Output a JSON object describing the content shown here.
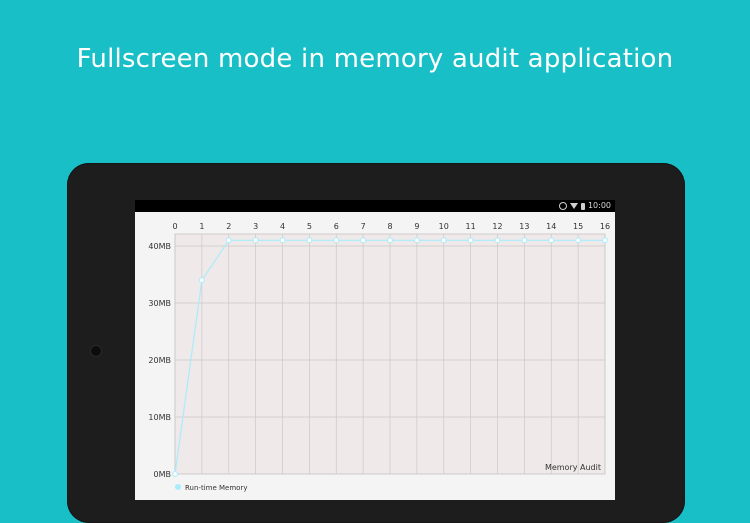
{
  "headline": "Fullscreen mode in memory audit application",
  "status_bar": {
    "time": "10:00",
    "icons": [
      "alarm-icon",
      "wifi-icon",
      "battery-icon"
    ]
  },
  "colors": {
    "background": "#19bfc6",
    "tablet_bezel": "#1d1d1d",
    "plot_bg": "#efe9e9",
    "series_line": "#a9ecfb",
    "series_point_fill": "#ffffff",
    "legend_marker": "#a9ecfb"
  },
  "chart_data": {
    "type": "line",
    "title": "Memory Audit",
    "x": [
      0,
      1,
      2,
      3,
      4,
      5,
      6,
      7,
      8,
      9,
      10,
      11,
      12,
      13,
      14,
      15,
      16
    ],
    "xlim": [
      0,
      16
    ],
    "x_ticks": [
      "0",
      "1",
      "2",
      "3",
      "4",
      "5",
      "6",
      "7",
      "8",
      "9",
      "10",
      "11",
      "12",
      "13",
      "14",
      "15",
      "16"
    ],
    "ylim": [
      0,
      40
    ],
    "y_ticks": [
      {
        "value": 0,
        "label": "0MB"
      },
      {
        "value": 10,
        "label": "10MB"
      },
      {
        "value": 20,
        "label": "20MB"
      },
      {
        "value": 30,
        "label": "30MB"
      },
      {
        "value": 40,
        "label": "40MB"
      }
    ],
    "x_axis_position": "top",
    "grid": true,
    "legend_position": "bottom-left",
    "series": [
      {
        "name": "Run-time Memory",
        "values": [
          0,
          34,
          41,
          41,
          41,
          41,
          41,
          41,
          41,
          41,
          41,
          41,
          41,
          41,
          41,
          41,
          41
        ]
      }
    ]
  }
}
